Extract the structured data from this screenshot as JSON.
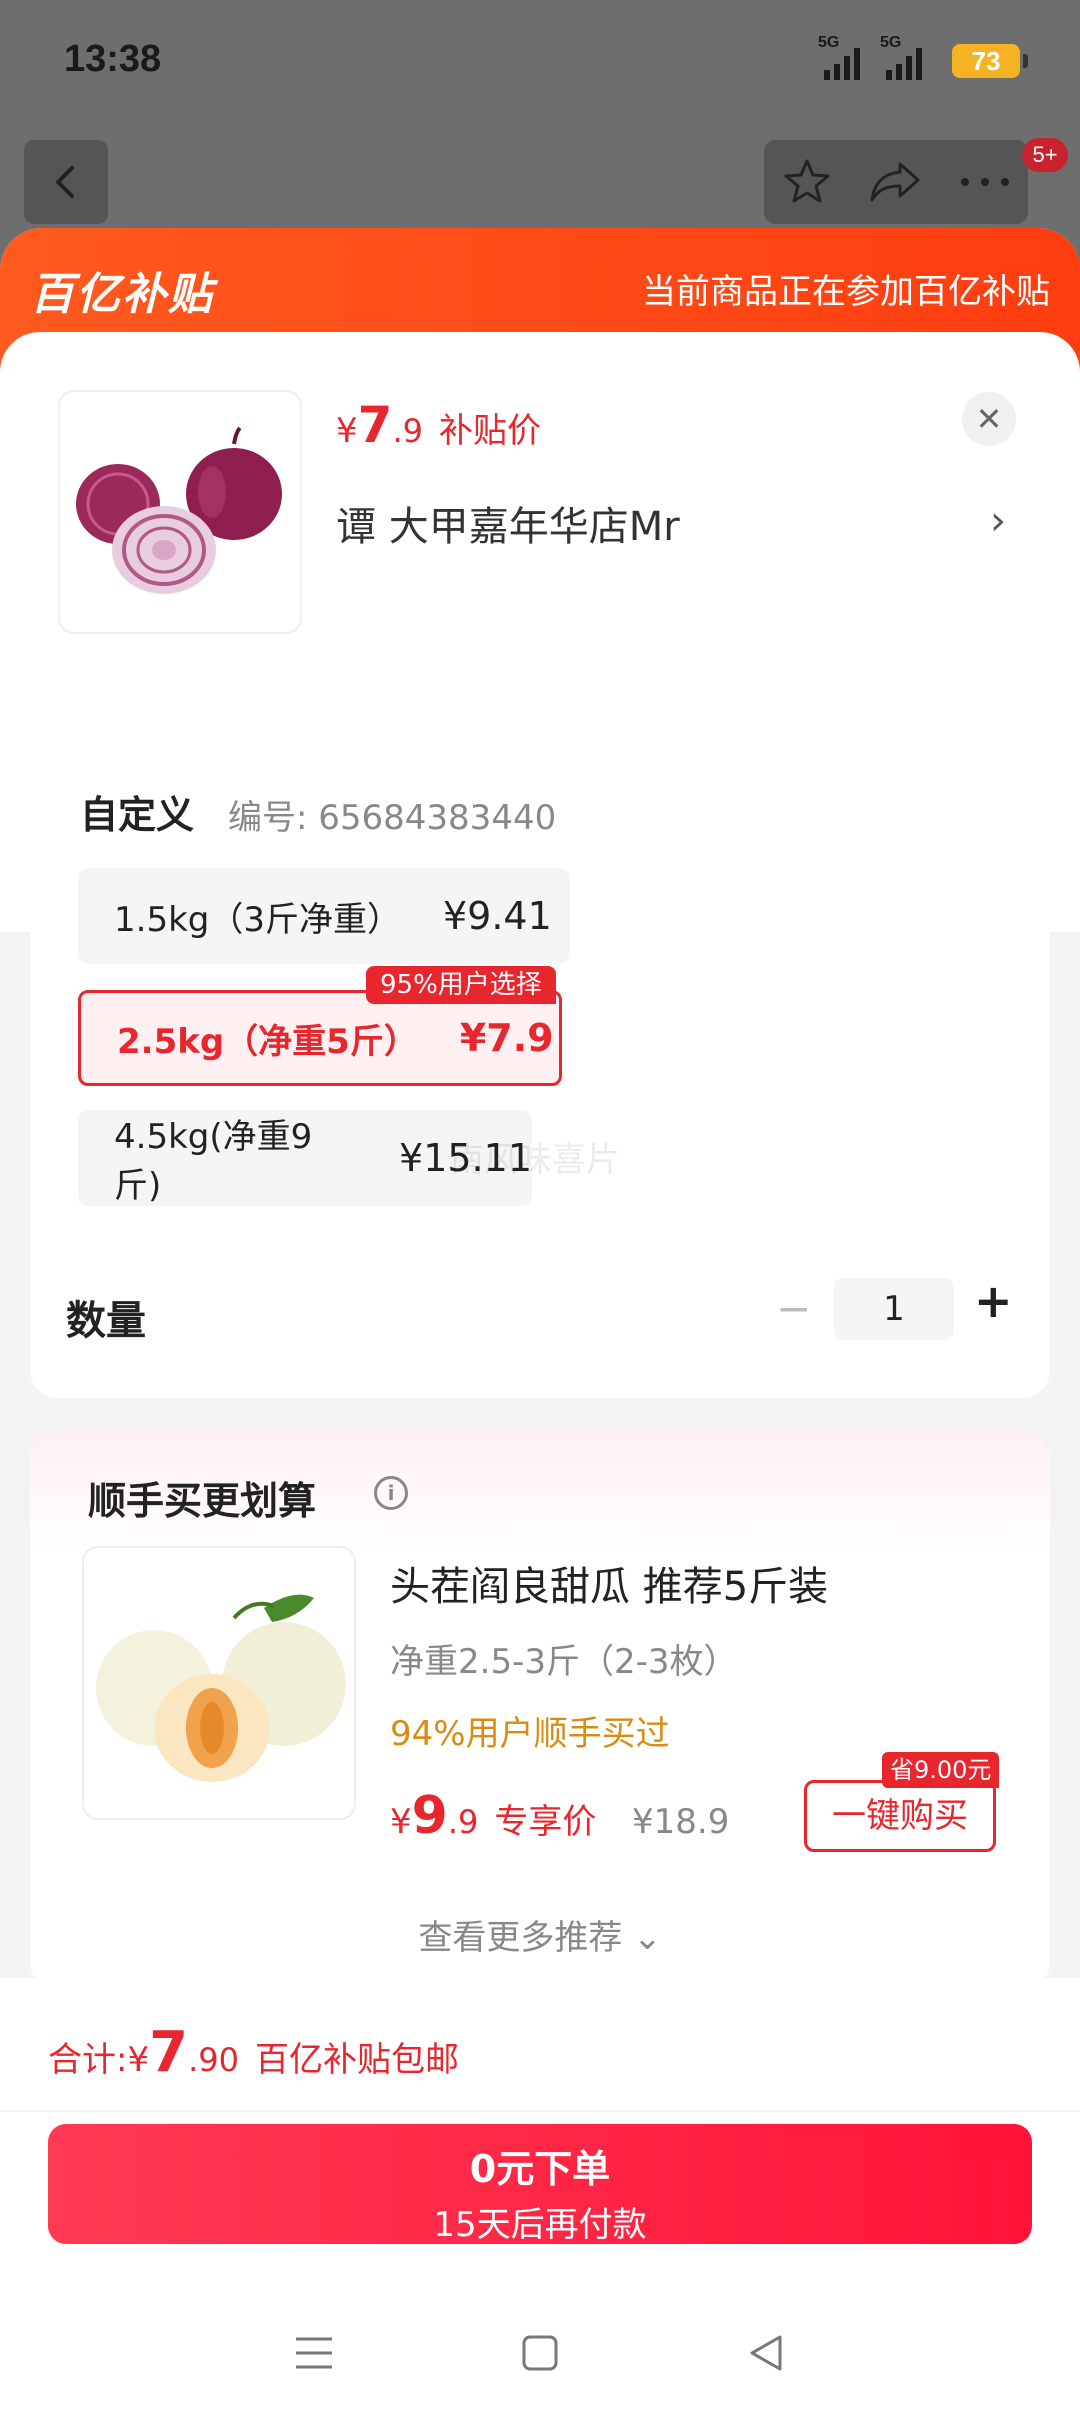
{
  "status_bar": {
    "time": "13:38",
    "signal1": "5G",
    "signal2": "5G",
    "battery": "73"
  },
  "top_nav": {
    "back_icon": "chevron-left-icon",
    "favorite_icon": "star-icon",
    "share_icon": "share-icon",
    "more_icon": "more-icon",
    "badge": "5+"
  },
  "banner": {
    "logo": "百亿补贴",
    "note": "当前商品正在参加百亿补贴"
  },
  "product": {
    "price_currency": "¥",
    "price_int": "7",
    "price_dec": ".9",
    "price_tag": "补贴价",
    "shop_name": "谭  大甲嘉年华店Mr",
    "shop_chevron": "›",
    "close": "✕"
  },
  "spec": {
    "title": "自定义",
    "code": "编号: 65684383440",
    "options": [
      {
        "label": "1.5kg（3斤净重）",
        "price": "¥9.41",
        "selected": false
      },
      {
        "label": "2.5kg（净重5斤）",
        "price": "¥7.9",
        "selected": true,
        "badge": "95%用户选择"
      },
      {
        "label": "4.5kg(净重9斤)",
        "price": "¥15.11",
        "selected": false
      }
    ],
    "watermark": "南风味喜片",
    "quantity_label": "数量",
    "quantity_minus": "−",
    "quantity_value": "1",
    "quantity_plus": "+"
  },
  "recommend": {
    "title": "顺手买更划算",
    "info_icon": "i",
    "item": {
      "name": "头茬阎良甜瓜 推荐5斤装",
      "weight": "净重2.5-3斤（2-3枚）",
      "popularity": "94%用户顺手买过",
      "price_currency": "¥",
      "price_int": "9",
      "price_dec": ".9",
      "price_tag": "专享价",
      "original_price": "¥18.9",
      "save_badge": "省9.00元",
      "buy_label": "一键购买"
    },
    "more_label": "查看更多推荐 ⌄"
  },
  "bottom": {
    "total_label": "合计: ",
    "total_currency": "¥",
    "total_int": "7",
    "total_dec": ".90",
    "total_note": "百亿补贴包邮",
    "order_line1": "0元下单",
    "order_line2": "15天后再付款"
  },
  "colors": {
    "accent": "#e8262d",
    "banner": "#ff5a1f",
    "order_button": "#ff2a45"
  }
}
